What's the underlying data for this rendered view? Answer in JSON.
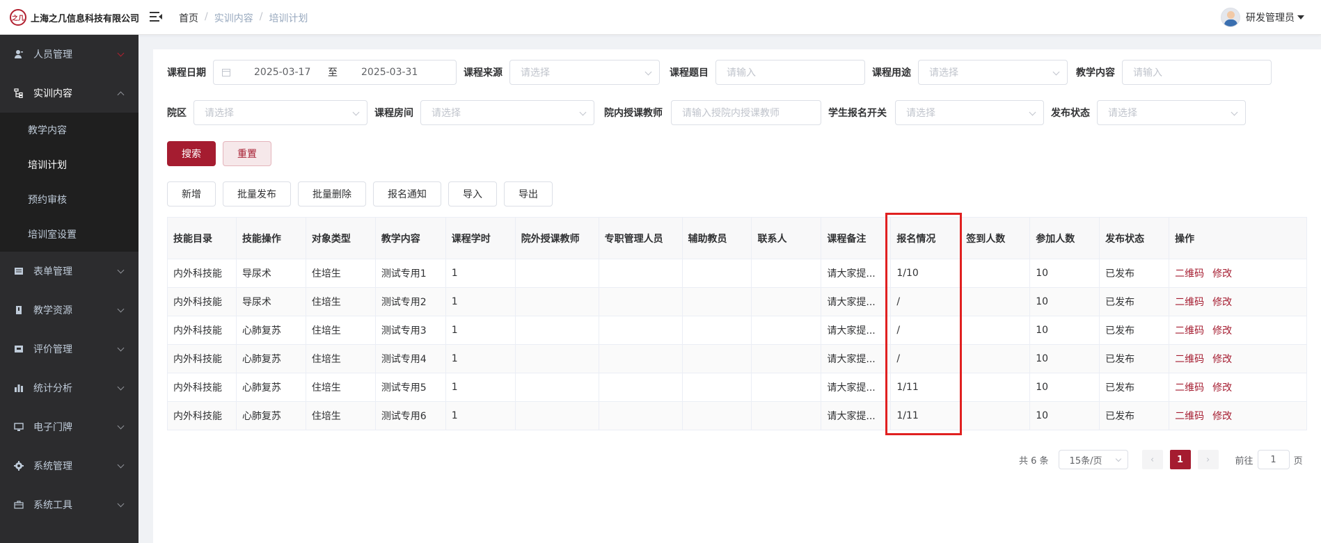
{
  "header": {
    "company": "上海之几信息科技有限公司",
    "logo_text": "之几",
    "breadcrumb": [
      "首页",
      "实训内容",
      "培训计划"
    ],
    "user_name": "研发管理员"
  },
  "sidebar": {
    "items": [
      {
        "label": "人员管理",
        "icon": "person-icon"
      },
      {
        "label": "实训内容",
        "icon": "tree-icon"
      },
      {
        "label": "表单管理",
        "icon": "form-icon"
      },
      {
        "label": "教学资源",
        "icon": "book-icon"
      },
      {
        "label": "评价管理",
        "icon": "rating-icon"
      },
      {
        "label": "统计分析",
        "icon": "chart-icon"
      },
      {
        "label": "电子门牌",
        "icon": "monitor-icon"
      },
      {
        "label": "系统管理",
        "icon": "gear-icon"
      },
      {
        "label": "系统工具",
        "icon": "toolbox-icon"
      }
    ],
    "sub_items": [
      "教学内容",
      "培训计划",
      "预约审核",
      "培训室设置"
    ]
  },
  "filters": {
    "course_date_label": "课程日期",
    "date_start": "2025-03-17",
    "date_sep": "至",
    "date_end": "2025-03-31",
    "course_source_label": "课程来源",
    "course_title_label": "课程题目",
    "course_use_label": "课程用途",
    "teaching_content_label": "教学内容",
    "campus_label": "院区",
    "course_direction_label": "课程房间",
    "outside_teacher_label": "院内授课教师",
    "outside_teacher_placeholder": "请输入授院内授课教师",
    "signup_switch_label": "学生报名开关",
    "publish_status_label": "发布状态",
    "placeholder_select": "请选择",
    "placeholder_input": "请输入"
  },
  "actions": {
    "search": "搜索",
    "reset": "重置",
    "toolbar": [
      "新增",
      "批量发布",
      "批量删除",
      "报名通知",
      "导入",
      "导出"
    ]
  },
  "table": {
    "headers": [
      "技能目录",
      "技能操作",
      "对象类型",
      "教学内容",
      "课程学时",
      "院外授课教师",
      "专职管理人员",
      "辅助教员",
      "联系人",
      "课程备注",
      "报名情况",
      "签到人数",
      "参加人数",
      "发布状态",
      "操作"
    ],
    "rows": [
      [
        "内外科技能",
        "导尿术",
        "住培生",
        "测试专用1",
        "1",
        "",
        "",
        "",
        "",
        "请大家提...",
        "1/10",
        "",
        "10",
        "已发布"
      ],
      [
        "内外科技能",
        "导尿术",
        "住培生",
        "测试专用2",
        "1",
        "",
        "",
        "",
        "",
        "请大家提...",
        "/",
        "",
        "10",
        "已发布"
      ],
      [
        "内外科技能",
        "心肺复苏",
        "住培生",
        "测试专用3",
        "1",
        "",
        "",
        "",
        "",
        "请大家提...",
        "/",
        "",
        "10",
        "已发布"
      ],
      [
        "内外科技能",
        "心肺复苏",
        "住培生",
        "测试专用4",
        "1",
        "",
        "",
        "",
        "",
        "请大家提...",
        "/",
        "",
        "10",
        "已发布"
      ],
      [
        "内外科技能",
        "心肺复苏",
        "住培生",
        "测试专用5",
        "1",
        "",
        "",
        "",
        "",
        "请大家提...",
        "1/11",
        "",
        "10",
        "已发布"
      ],
      [
        "内外科技能",
        "心肺复苏",
        "住培生",
        "测试专用6",
        "1",
        "",
        "",
        "",
        "",
        "请大家提...",
        "1/11",
        "",
        "10",
        "已发布"
      ]
    ],
    "op_qrcode": "二维码",
    "op_edit": "修改"
  },
  "pagination": {
    "total": "共 6 条",
    "page_size": "15条/页",
    "current_page": "1",
    "goto_label": "前往",
    "goto_value": "1",
    "page_unit": "页"
  },
  "colors": {
    "accent": "#a51c30",
    "sidebar_bg": "#2c2c2e",
    "highlight": "#e02020"
  }
}
